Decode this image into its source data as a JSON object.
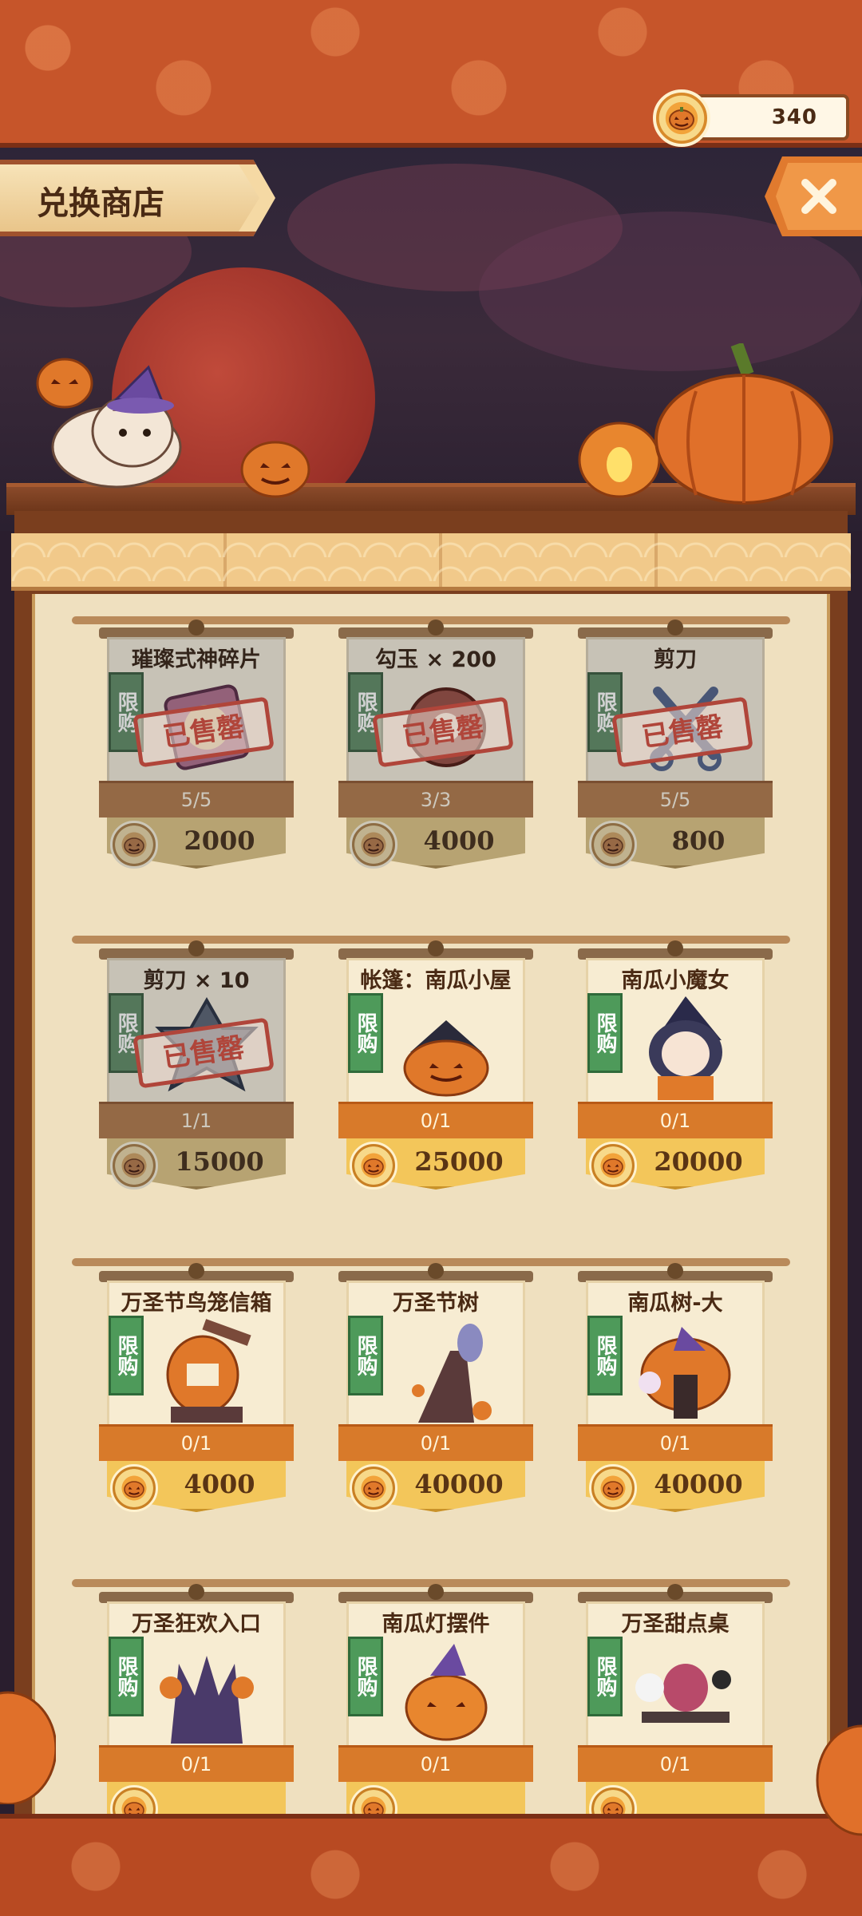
{
  "header": {
    "title": "兑换商店",
    "currency_value": "340",
    "close_icon": "close-icon"
  },
  "colors": {
    "banner": "#c6552a",
    "accent_orange": "#d87a2a",
    "price_gold": "#f3c65a",
    "limit_green": "#4e9a5a",
    "sold_red": "#b0453a"
  },
  "items": [
    {
      "name": "璀璨式神碎片",
      "limit": "限购",
      "stock": "5/5",
      "price": "2000",
      "sold": true,
      "status": "已售罄",
      "icon": "shikigami-shard-icon"
    },
    {
      "name": "勾玉 × 200",
      "limit": "限购",
      "stock": "3/3",
      "price": "4000",
      "sold": true,
      "status": "已售罄",
      "icon": "magatama-icon"
    },
    {
      "name": "剪刀",
      "limit": "限购",
      "stock": "5/5",
      "price": "800",
      "sold": true,
      "status": "已售罄",
      "icon": "scissors-icon"
    },
    {
      "name": "剪刀 × 10",
      "limit": "限购",
      "stock": "1/1",
      "price": "15000",
      "sold": true,
      "status": "已售罄",
      "icon": "scissors-pack-icon"
    },
    {
      "name": "帐篷：南瓜小屋",
      "limit": "限购",
      "stock": "0/1",
      "price": "25000",
      "sold": false,
      "status": "",
      "icon": "pumpkin-house-icon"
    },
    {
      "name": "南瓜小魔女",
      "limit": "限购",
      "stock": "0/1",
      "price": "20000",
      "sold": false,
      "status": "",
      "icon": "pumpkin-witch-icon"
    },
    {
      "name": "万圣节鸟笼信箱",
      "limit": "限购",
      "stock": "0/1",
      "price": "4000",
      "sold": false,
      "status": "",
      "icon": "birdcage-mailbox-icon"
    },
    {
      "name": "万圣节树",
      "limit": "限购",
      "stock": "0/1",
      "price": "40000",
      "sold": false,
      "status": "",
      "icon": "halloween-tree-icon"
    },
    {
      "name": "南瓜树-大",
      "limit": "限购",
      "stock": "0/1",
      "price": "40000",
      "sold": false,
      "status": "",
      "icon": "pumpkin-tree-icon"
    },
    {
      "name": "万圣狂欢入口",
      "limit": "限购",
      "stock": "0/1",
      "price": "",
      "sold": false,
      "status": "",
      "icon": "carnival-gate-icon"
    },
    {
      "name": "南瓜灯摆件",
      "limit": "限购",
      "stock": "0/1",
      "price": "",
      "sold": false,
      "status": "",
      "icon": "jack-o-lantern-icon"
    },
    {
      "name": "万圣甜点桌",
      "limit": "限购",
      "stock": "0/1",
      "price": "",
      "sold": false,
      "status": "",
      "icon": "dessert-table-icon"
    }
  ]
}
